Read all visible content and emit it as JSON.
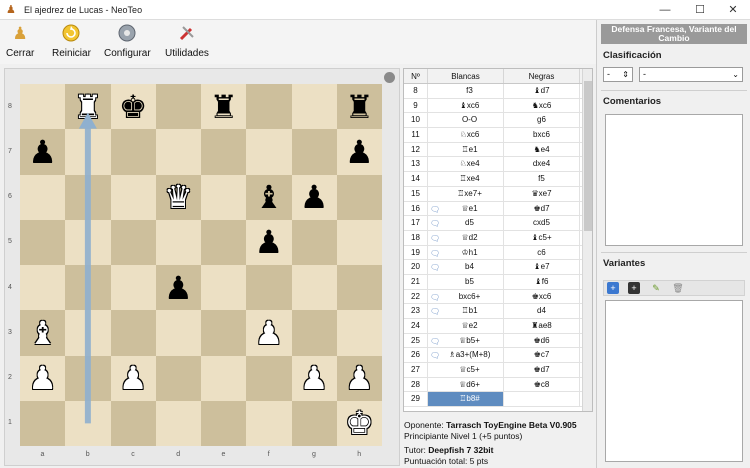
{
  "window": {
    "title": "El ajedrez de Lucas - NeoTeo",
    "controls": [
      "—",
      "☐",
      "✕"
    ]
  },
  "toolbar": [
    {
      "label": "Cerrar",
      "icon": "pawn-icon"
    },
    {
      "label": "Reiniciar",
      "icon": "restart-icon"
    },
    {
      "label": "Configurar",
      "icon": "gear-icon"
    },
    {
      "label": "Utilidades",
      "icon": "tools-icon"
    }
  ],
  "board": {
    "ranks": [
      "8",
      "7",
      "6",
      "5",
      "4",
      "3",
      "2",
      "1"
    ],
    "files": [
      "a",
      "b",
      "c",
      "d",
      "e",
      "f",
      "g",
      "h"
    ],
    "pieces": [
      {
        "sq": "b8",
        "glyph": "♜",
        "side": "w"
      },
      {
        "sq": "c8",
        "glyph": "♚",
        "side": "b"
      },
      {
        "sq": "e8",
        "glyph": "♜",
        "side": "b"
      },
      {
        "sq": "h8",
        "glyph": "♜",
        "side": "b"
      },
      {
        "sq": "a7",
        "glyph": "♟",
        "side": "b"
      },
      {
        "sq": "h7",
        "glyph": "♟",
        "side": "b"
      },
      {
        "sq": "d6",
        "glyph": "♛",
        "side": "w"
      },
      {
        "sq": "f6",
        "glyph": "♝",
        "side": "b"
      },
      {
        "sq": "g6",
        "glyph": "♟",
        "side": "b"
      },
      {
        "sq": "f5",
        "glyph": "♟",
        "side": "b"
      },
      {
        "sq": "d4",
        "glyph": "♟",
        "side": "b"
      },
      {
        "sq": "a3",
        "glyph": "♝",
        "side": "w"
      },
      {
        "sq": "f3",
        "glyph": "♟",
        "side": "w"
      },
      {
        "sq": "a2",
        "glyph": "♟",
        "side": "w"
      },
      {
        "sq": "c2",
        "glyph": "♟",
        "side": "w"
      },
      {
        "sq": "g2",
        "glyph": "♟",
        "side": "w"
      },
      {
        "sq": "h2",
        "glyph": "♟",
        "side": "w"
      },
      {
        "sq": "h1",
        "glyph": "♚",
        "side": "w"
      }
    ],
    "last_move": {
      "from": "b1",
      "to": "b8"
    }
  },
  "moves": {
    "headers": {
      "num": "Nº",
      "white": "Blancas",
      "black": "Negras"
    },
    "rows": [
      {
        "n": "8",
        "w": "f3",
        "b": "♝d7",
        "cmt": false
      },
      {
        "n": "9",
        "w": "♝xc6",
        "b": "♞xc6",
        "cmt": false
      },
      {
        "n": "10",
        "w": "O-O",
        "b": "g6",
        "cmt": false
      },
      {
        "n": "11",
        "w": "♘xc6",
        "b": "bxc6",
        "cmt": false
      },
      {
        "n": "12",
        "w": "♖e1",
        "b": "♞e4",
        "cmt": false
      },
      {
        "n": "13",
        "w": "♘xe4",
        "b": "dxe4",
        "cmt": false
      },
      {
        "n": "14",
        "w": "♖xe4",
        "b": "f5",
        "cmt": false
      },
      {
        "n": "15",
        "w": "♖xe7+",
        "b": "♛xe7",
        "cmt": false
      },
      {
        "n": "16",
        "w": "♕e1",
        "b": "♚d7",
        "cmt": true
      },
      {
        "n": "17",
        "w": "d5",
        "b": "cxd5",
        "cmt": true
      },
      {
        "n": "18",
        "w": "♕d2",
        "b": "♝c5+",
        "cmt": true
      },
      {
        "n": "19",
        "w": "♔h1",
        "b": "c6",
        "cmt": true
      },
      {
        "n": "20",
        "w": "b4",
        "b": "♝e7",
        "cmt": true
      },
      {
        "n": "21",
        "w": "b5",
        "b": "♝f6",
        "cmt": false
      },
      {
        "n": "22",
        "w": "bxc6+",
        "b": "♚xc6",
        "cmt": true
      },
      {
        "n": "23",
        "w": "♖b1",
        "b": "d4",
        "cmt": true
      },
      {
        "n": "24",
        "w": "♕e2",
        "b": "♜ae8",
        "cmt": false
      },
      {
        "n": "25",
        "w": "♕b5+",
        "b": "♚d6",
        "cmt": true
      },
      {
        "n": "26",
        "w": "♗a3+(M+8)",
        "b": "♚c7",
        "cmt": true
      },
      {
        "n": "27",
        "w": "♕c5+",
        "b": "♚d7",
        "cmt": false
      },
      {
        "n": "28",
        "w": "♕d6+",
        "b": "♚c8",
        "cmt": false
      },
      {
        "n": "29",
        "w": "♖b8#",
        "b": "",
        "cmt": false,
        "selected": true
      }
    ]
  },
  "info": {
    "opponent_label": "Oponente:",
    "opponent": "Tarrasch ToyEngine Beta V0.905",
    "level": "Principiante Nivel 1 (+5 puntos)",
    "tutor_label": "Tutor:",
    "tutor": "Deepfish 7 32bit",
    "score": "Puntuación total: 5 pts"
  },
  "sidebar": {
    "opening": "Defensa Francesa, Variante del Cambio",
    "classification_title": "Clasificación",
    "class_select_1": "-",
    "class_select_2": "-",
    "comments_title": "Comentarios",
    "variants_title": "Variantes"
  },
  "colors": {
    "light_square": "#ece0c4",
    "dark_square": "#cdbf9c",
    "selection": "#5f8cc0",
    "arrow": "#8fb0cf"
  }
}
